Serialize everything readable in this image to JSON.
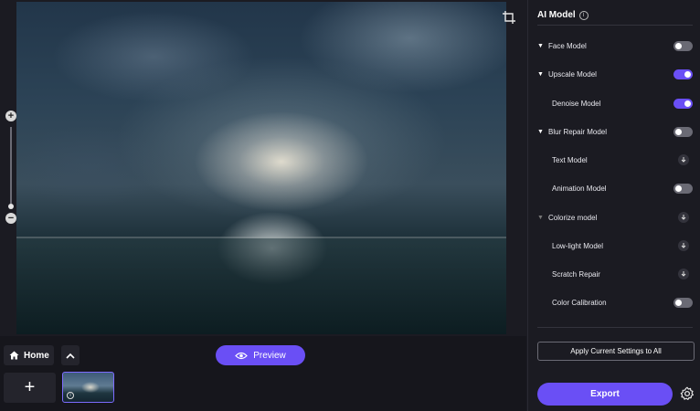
{
  "panel": {
    "title": "AI Model",
    "models": [
      {
        "label": "Face Model",
        "caret": "down",
        "control": "toggle",
        "on": false
      },
      {
        "label": "Upscale Model",
        "caret": "down",
        "control": "toggle",
        "on": true
      },
      {
        "label": "Denoise Model",
        "caret": "none",
        "control": "toggle",
        "on": true
      },
      {
        "label": "Blur Repair Model",
        "caret": "down",
        "control": "toggle",
        "on": false
      },
      {
        "label": "Text Model",
        "caret": "none",
        "control": "download"
      },
      {
        "label": "Animation Model",
        "caret": "none",
        "control": "toggle",
        "on": false
      },
      {
        "label": "Colorize model",
        "caret": "down-dim",
        "control": "download"
      },
      {
        "label": "Low-light Model",
        "caret": "none",
        "control": "download"
      },
      {
        "label": "Scratch Repair",
        "caret": "none",
        "control": "download"
      },
      {
        "label": "Color Calibration",
        "caret": "none",
        "control": "toggle",
        "on": false
      }
    ],
    "apply_label": "Apply Current Settings to All",
    "export_label": "Export"
  },
  "bottom": {
    "home_label": "Home",
    "preview_label": "Preview",
    "add_label": "+"
  },
  "colors": {
    "accent": "#6a4ff5",
    "background": "#1b1b22"
  },
  "icons": {
    "crop": "crop-icon",
    "zoom_in": "zoom-in-icon",
    "zoom_out": "zoom-out-icon",
    "home": "home-icon",
    "chevron_up": "chevron-up-icon",
    "eye": "eye-icon",
    "settings": "gear-icon",
    "info": "info-icon",
    "download": "download-icon"
  }
}
